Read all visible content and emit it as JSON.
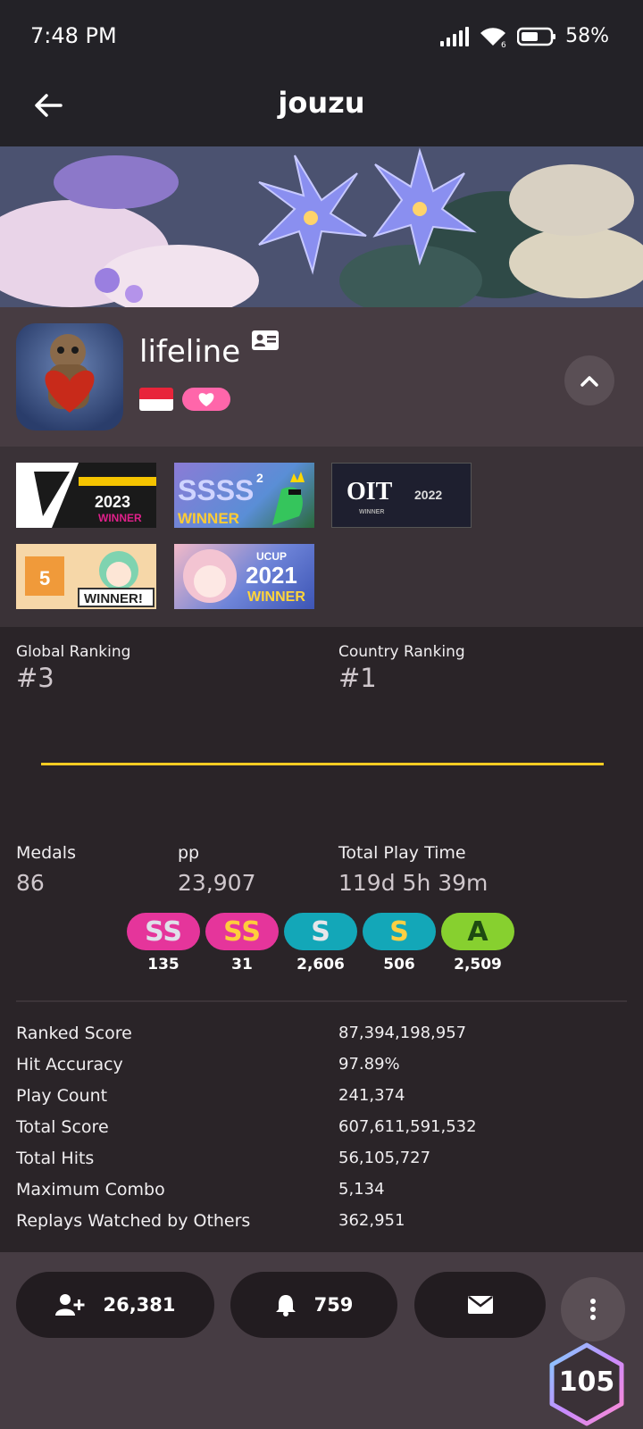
{
  "status_bar": {
    "time": "7:48 PM",
    "battery_text": "58%",
    "icons": [
      "signal-icon",
      "wifi-icon",
      "battery-icon"
    ]
  },
  "header": {
    "title": "jouzu",
    "back_icon": "back-arrow-icon"
  },
  "profile": {
    "username": "lifeline",
    "country_flag": "indonesia-flag",
    "supporter_icon": "heart-icon",
    "id_icon": "id-card-icon",
    "collapse_icon": "chevron-up-icon"
  },
  "badges": [
    {
      "name": "2023 WINNER"
    },
    {
      "name": "SSSS² WINNER"
    },
    {
      "name": "OIT 2022 WINNER"
    },
    {
      "name": "5 WINNER!"
    },
    {
      "name": "UCUP 2021 WINNER"
    }
  ],
  "rankings": {
    "global_label": "Global Ranking",
    "global_value": "#3",
    "country_label": "Country Ranking",
    "country_value": "#1"
  },
  "summary": {
    "medals_label": "Medals",
    "medals_value": "86",
    "pp_label": "pp",
    "pp_value": "23,907",
    "playtime_label": "Total Play Time",
    "playtime_value": "119d 5h 39m"
  },
  "grades": [
    {
      "grade": "SS",
      "count": "135",
      "color": "#e5359b",
      "text_color": "#dfe0ea"
    },
    {
      "grade": "SS",
      "count": "31",
      "color": "#e5359b",
      "text_color": "#ffcd3c"
    },
    {
      "grade": "S",
      "count": "2,606",
      "color": "#13a7b8",
      "text_color": "#e6e6ea"
    },
    {
      "grade": "S",
      "count": "506",
      "color": "#13a7b8",
      "text_color": "#ffd043"
    },
    {
      "grade": "A",
      "count": "2,509",
      "color": "#87d02f",
      "text_color": "#1e4a12"
    }
  ],
  "stats": [
    {
      "label": "Ranked Score",
      "value": "87,394,198,957"
    },
    {
      "label": "Hit Accuracy",
      "value": "97.89%"
    },
    {
      "label": "Play Count",
      "value": "241,374"
    },
    {
      "label": "Total Score",
      "value": "607,611,591,532"
    },
    {
      "label": "Total Hits",
      "value": "56,105,727"
    },
    {
      "label": "Maximum Combo",
      "value": "5,134"
    },
    {
      "label": "Replays Watched by Others",
      "value": "362,951"
    }
  ],
  "actions": {
    "followers_count": "26,381",
    "mapping_subscribers": "759",
    "followers_icon": "add-user-icon",
    "subscribers_icon": "bell-icon",
    "message_icon": "mail-icon",
    "more_icon": "more-vertical-icon"
  },
  "level": {
    "value": "105"
  }
}
